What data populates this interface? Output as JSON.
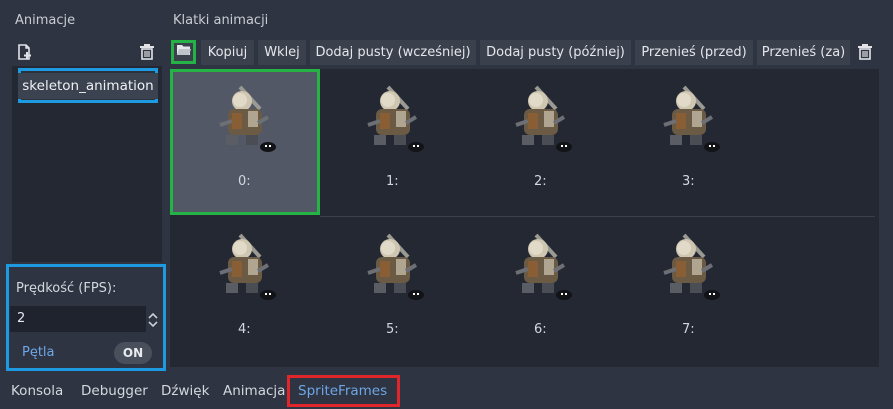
{
  "left_panel": {
    "title": "Animacje",
    "animation_name": "skeleton_animation",
    "speed_label": "Prędkość (FPS):",
    "fps_value": "2",
    "loop_label": "Pętla",
    "loop_toggle": "ON"
  },
  "right_panel": {
    "title": "Klatki animacji",
    "toolbar": {
      "copy": "Kopiuj",
      "paste": "Wklej",
      "add_empty_before": "Dodaj pusty (wcześniej)",
      "add_empty_after": "Dodaj pusty (później)",
      "move_before": "Przenieś (przed)",
      "move_after": "Przenieś (za)"
    },
    "frames": [
      {
        "label": "0:"
      },
      {
        "label": "1:"
      },
      {
        "label": "2:"
      },
      {
        "label": "3:"
      },
      {
        "label": "4:"
      },
      {
        "label": "5:"
      },
      {
        "label": "6:"
      },
      {
        "label": "7:"
      }
    ],
    "selected_frame": 0
  },
  "bottom_tabs": {
    "console": "Konsola",
    "debugger": "Debugger",
    "audio": "Dźwięk",
    "animation": "Animacja",
    "spriteframes": "SpriteFrames"
  },
  "colors": {
    "accent": "#6ea7e6",
    "highlight_blue": "#1e9ae0",
    "highlight_green": "#26b346",
    "highlight_red": "#e0262b"
  },
  "icons": {
    "new_animation": "new-animation-icon",
    "delete_animation": "trash-icon",
    "load_frames": "folder-open-icon",
    "delete_frame": "trash-icon",
    "frame_sprite": "skeleton-sprite-icon"
  }
}
